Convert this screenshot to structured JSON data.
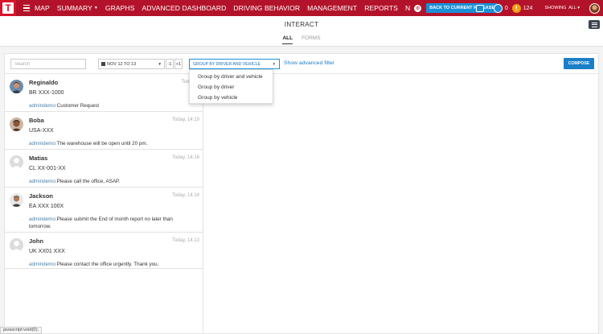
{
  "nav": {
    "logo_letter": "T",
    "items": [
      {
        "label": "MAP",
        "has_caret": false
      },
      {
        "label": "SUMMARY",
        "has_caret": true
      },
      {
        "label": "GRAPHS",
        "has_caret": false
      },
      {
        "label": "ADVANCED DASHBOARD",
        "has_caret": false
      },
      {
        "label": "DRIVING BEHAVIOR",
        "has_caret": false
      },
      {
        "label": "MANAGEMENT",
        "has_caret": false
      },
      {
        "label": "REPORTS",
        "has_caret": false
      },
      {
        "label": "N",
        "has_caret": false
      }
    ],
    "release_button": "BACK TO CURRENT RELEASE",
    "messages_count": "0",
    "alerts_count": "124",
    "showing_label": "SHOWING",
    "showing_value": "ALL",
    "colors": {
      "bar": "#b3132a",
      "accent": "#1a8fd8",
      "alert": "#f39c12"
    }
  },
  "page": {
    "title": "INTERACT",
    "tabs": [
      {
        "label": "ALL",
        "active": true
      },
      {
        "label": "FORMS",
        "active": false
      }
    ]
  },
  "toolbar": {
    "search_placeholder": "Search",
    "date_range": "NOV 12 TO 13",
    "minus_label": "-1",
    "plus_label": "+1",
    "group_selected": "GROUP BY DRIVER AND VEHICLE",
    "advanced_filter": "Show advanced filter",
    "compose": "COMPOSE"
  },
  "group_options": [
    "Group by driver and vehicle",
    "Group by driver",
    "Group by vehicle"
  ],
  "messages": [
    {
      "name": "Reginaldo",
      "time": "Today, 1",
      "plate": "BR XXX-1000",
      "sender": "admindemo:",
      "text": "Customer Request",
      "avatar": "person-photo-icon"
    },
    {
      "name": "Boba",
      "time": "Today, 14:19",
      "plate": "USA-XXX",
      "sender": "admindemo:",
      "text": "The warehouse will be open until 20 pm.",
      "avatar": "person-photo-icon"
    },
    {
      "name": "Matias",
      "time": "Today, 14:16",
      "plate": "CL XX-001-XX",
      "sender": "admindemo:",
      "text": "Please call the office, ASAP.",
      "avatar": "default-avatar-icon"
    },
    {
      "name": "Jackson",
      "time": "Today, 14:14",
      "plate": "EA XXX 100X",
      "sender": "admindemo:",
      "text": "Please submit the End of month report no later than tomorrow.",
      "avatar": "person-photo-icon"
    },
    {
      "name": "John",
      "time": "Today, 14:13",
      "plate": "UK XX01 XXX",
      "sender": "admindemo:",
      "text": "Please contact the office urgently. Thank you.",
      "avatar": "default-avatar-icon"
    }
  ],
  "status_bar": "javascript:void(0);"
}
